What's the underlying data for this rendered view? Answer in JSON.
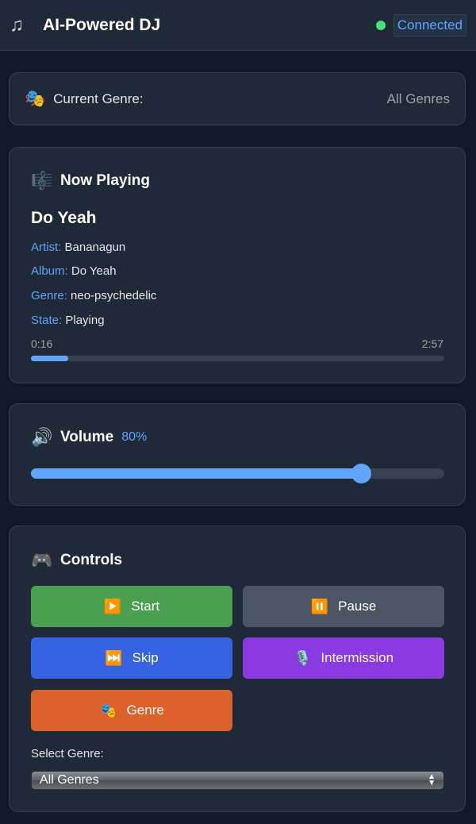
{
  "header": {
    "app_icon": "♫",
    "title": "AI-Powered DJ",
    "status_label": "Connected",
    "status_color": "#4ade80"
  },
  "current_genre": {
    "icon": "🎭",
    "label": "Current Genre:",
    "value": "All Genres"
  },
  "now_playing": {
    "icon": "🎼",
    "heading": "Now Playing",
    "track_title": "Do Yeah",
    "artist_key": "Artist:",
    "artist": "Bananagun",
    "album_key": "Album:",
    "album": "Do Yeah",
    "genre_key": "Genre:",
    "genre": "neo-psychedelic",
    "state_key": "State:",
    "state": "Playing",
    "elapsed": "0:16",
    "duration": "2:57",
    "progress_fraction": 0.09
  },
  "volume": {
    "icon": "🔊",
    "heading": "Volume",
    "percent_label": "80%",
    "level_fraction": 0.8
  },
  "controls": {
    "icon": "🎮",
    "heading": "Controls",
    "buttons": [
      {
        "icon": "▶️",
        "label": "Start"
      },
      {
        "icon": "⏸️",
        "label": "Pause"
      },
      {
        "icon": "⏭️",
        "label": "Skip"
      },
      {
        "icon": "🎙️",
        "label": "Intermission"
      },
      {
        "icon": "🎭",
        "label": "Genre"
      }
    ],
    "select_label": "Select Genre:",
    "select_value": "All Genres"
  },
  "colors": {
    "accent": "#60a5fa",
    "start": "#4a9f50",
    "pause": "#4b5563",
    "skip": "#3563e3",
    "intermission": "#8b3ae2",
    "genre": "#db622a"
  }
}
